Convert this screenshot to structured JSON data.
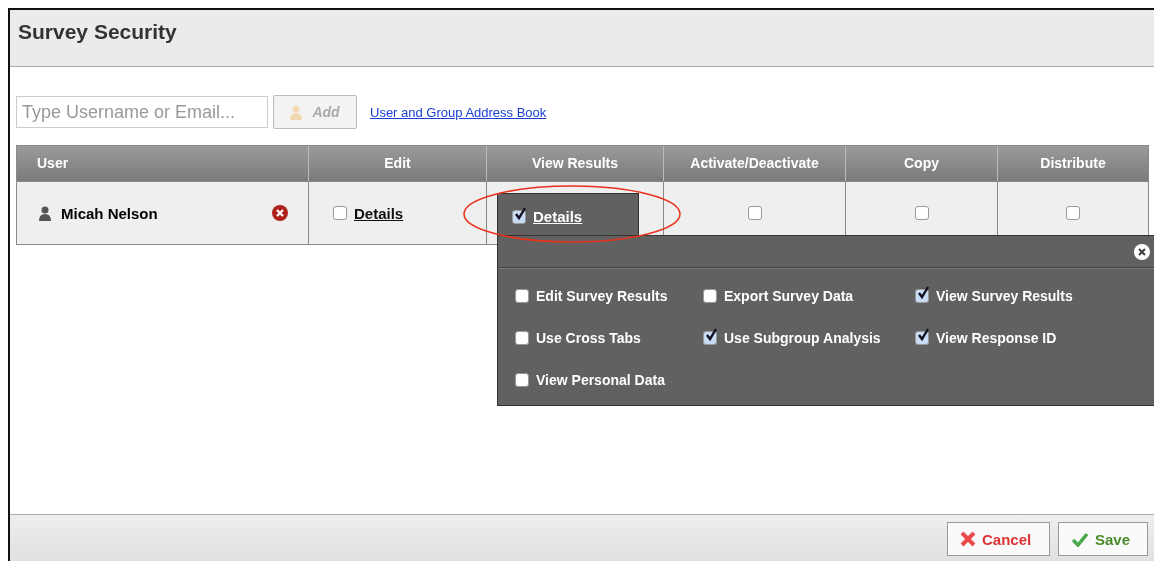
{
  "window": {
    "title": "Survey Security"
  },
  "toolbar": {
    "search": {
      "placeholder": "Type Username or Email..."
    },
    "add_button": "Add",
    "address_book_link": "User and Group Address Book"
  },
  "table": {
    "columns": [
      "User",
      "Edit",
      "View Results",
      "Activate/Deactivate",
      "Copy",
      "Distribute"
    ],
    "rows": [
      {
        "cells": [
          {
            "kind": "user",
            "label": "Micah Nelson"
          },
          {
            "kind": "details",
            "label": "Details",
            "checked": false,
            "expanded": false
          },
          {
            "kind": "details",
            "label": "Details",
            "checked": true,
            "expanded": true
          },
          {
            "kind": "checkbox",
            "checked": false
          },
          {
            "kind": "checkbox",
            "checked": false
          },
          {
            "kind": "checkbox",
            "checked": false
          }
        ]
      }
    ]
  },
  "popup": {
    "options": [
      {
        "label": "Edit Survey Results",
        "checked": false
      },
      {
        "label": "Export Survey Data",
        "checked": false
      },
      {
        "label": "View Survey Results",
        "checked": true
      },
      {
        "label": "Use Cross Tabs",
        "checked": false
      },
      {
        "label": "Use Subgroup Analysis",
        "checked": true
      },
      {
        "label": "View Response ID",
        "checked": true
      },
      {
        "label": "View Personal Data",
        "checked": false
      }
    ]
  },
  "footer": {
    "buttons": [
      {
        "kind": "cancel",
        "label": "Cancel"
      },
      {
        "kind": "save",
        "label": "Save"
      }
    ]
  }
}
